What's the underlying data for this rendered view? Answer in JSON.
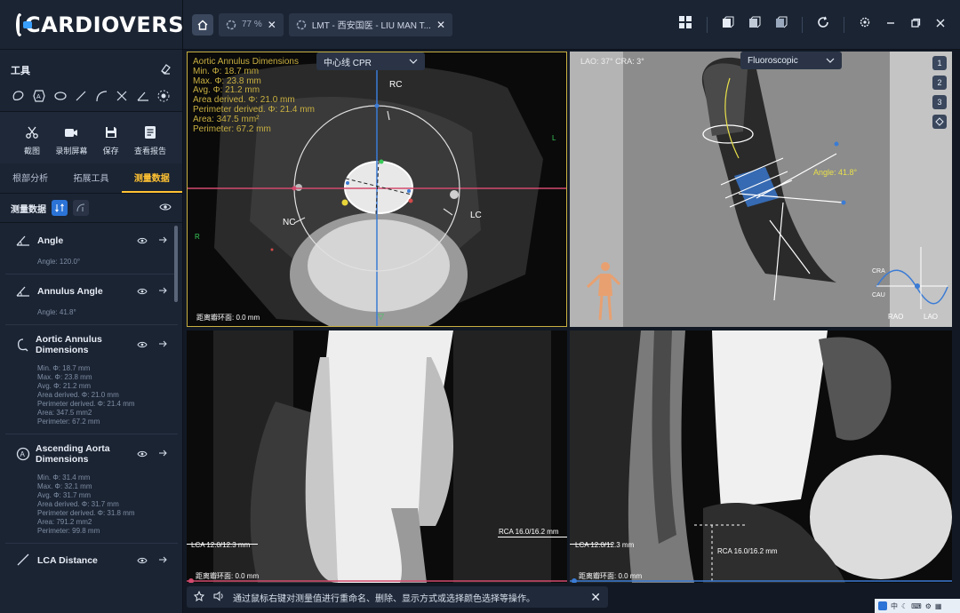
{
  "app": {
    "logo_text": "CARDIOVERSE"
  },
  "tools": {
    "title": "工具"
  },
  "actions": [
    {
      "label": "截图",
      "icon": "scissors-icon"
    },
    {
      "label": "录制屏幕",
      "icon": "video-icon"
    },
    {
      "label": "保存",
      "icon": "save-icon"
    },
    {
      "label": "查看报告",
      "icon": "report-icon"
    }
  ],
  "subtabs": [
    "根部分析",
    "拓展工具",
    "测量数据"
  ],
  "measure": {
    "title": "测量数据"
  },
  "measurements": [
    {
      "title": "Angle",
      "details": [
        "Angle: 120.0°"
      ]
    },
    {
      "title": "Annulus Angle",
      "details": [
        "Angle:  41.8°"
      ]
    },
    {
      "title": "Aortic Annulus Dimensions",
      "details": [
        "Min. Φ: 18.7 mm",
        "Max. Φ: 23.8 mm",
        "Avg. Φ: 21.2 mm",
        "Area derived. Φ: 21.0 mm",
        "Perimeter derived. Φ: 21.4 mm",
        "Area: 347.5 mm2",
        "Perimeter: 67.2 mm"
      ]
    },
    {
      "title": "Ascending Aorta Dimensions",
      "details": [
        "Min. Φ: 31.4 mm",
        "Max. Φ: 32.1 mm",
        "Avg. Φ: 31.7 mm",
        "Area derived. Φ: 31.7 mm",
        "Perimeter derived. Φ: 31.8 mm",
        "Area: 791.2 mm2",
        "Perimeter: 99.8 mm"
      ]
    },
    {
      "title": "LCA Distance",
      "details": []
    }
  ],
  "topbar": {
    "tab1_label": "77 %",
    "tab2_label": "LMT - 西安国医 - LIU MAN T..."
  },
  "vp1": {
    "dropdown": "中心线 CPR",
    "overlay": [
      "Aortic Annulus Dimensions",
      "Min. Φ: 18.7 mm",
      "Max. Φ: 23.8 mm",
      "Avg. Φ: 21.2 mm",
      "Area derived. Φ: 21.0 mm",
      "Perimeter derived. Φ: 21.4 mm",
      "Area: 347.5 mm²",
      "Perimeter: 67.2 mm"
    ],
    "rc": "RC",
    "nc": "NC",
    "lc": "LC",
    "l": "L",
    "r": "R",
    "distance": "距离瓣环面: 0.0 mm"
  },
  "vp2": {
    "orientation": "LAO: 37° CRA: 3°",
    "dropdown": "Fluoroscopic",
    "angle_label": "Angle: 41.8°",
    "buttons": [
      "1",
      "2",
      "3"
    ],
    "cau": "CAU",
    "cra": "CRA",
    "rao": "RAO",
    "lao": "LAO"
  },
  "vp3": {
    "lca": "LCA  12.0/12.3 mm",
    "rca": "RCA  16.0/16.2 mm",
    "distance": "距离瓣环面: 0.0 mm"
  },
  "vp4": {
    "lca": "LCA  12.0/12.3 mm",
    "rca": "RCA  16.0/16.2 mm",
    "distance": "距离瓣环面: 0.0 mm"
  },
  "hint": {
    "text": "通过鼠标右键对测量值进行重命名、删除、显示方式或选择颜色选择等操作。"
  },
  "taskbar": {
    "ime": "中"
  }
}
